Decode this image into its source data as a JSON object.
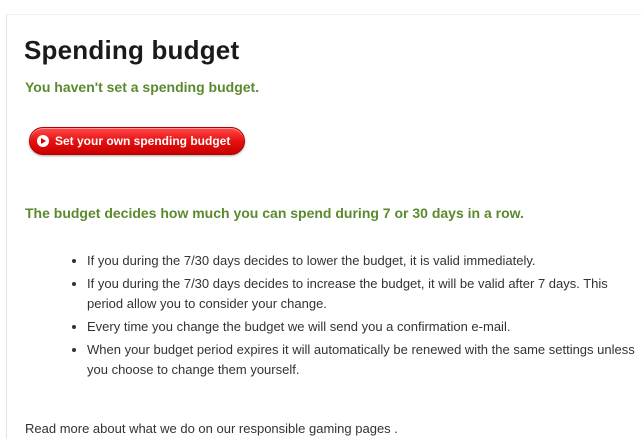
{
  "header": {
    "title": "Spending budget",
    "status": "You haven't set a spending budget."
  },
  "actions": {
    "set_budget_label": "Set your own spending budget"
  },
  "info": {
    "lead": "The budget decides how much you can spend during 7 or 30 days in a row.",
    "bullets": [
      "If you during the 7/30 days decides to lower the budget, it is valid immediately.",
      "If you during the 7/30 days decides to increase the budget, it will be valid after 7 days. This period allow you to consider your change.",
      "Every time you change the budget we will send you a confirmation e-mail.",
      "When your budget period expires it will automatically be renewed with the same settings unless you choose to change them yourself."
    ]
  },
  "footer": {
    "text": "Read more about what we do on our responsible gaming pages ."
  },
  "icons": {
    "cta": "arrow-circle-icon"
  },
  "colors": {
    "accent_green": "#5b8a2e",
    "button_red": "#e81010",
    "text": "#333333"
  }
}
